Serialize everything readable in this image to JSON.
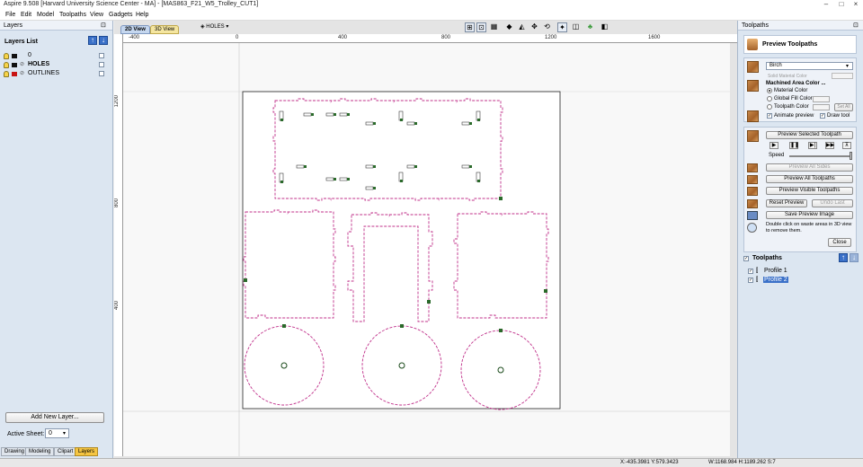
{
  "window": {
    "title": "Aspire 9.508 [Harvard University Science Center - MA] - [MAS863_F21_W5_Trolley_CUT1]",
    "controls": [
      "–",
      "□",
      "×"
    ]
  },
  "menu": [
    "File",
    "Edit",
    "Model",
    "Toolpaths",
    "View",
    "Gadgets",
    "Help"
  ],
  "left_panel": {
    "header": "Layers",
    "section_title": "Layers List",
    "layers": [
      {
        "name": "0",
        "color": "#000000"
      },
      {
        "name": "HOLES",
        "color": "#000000"
      },
      {
        "name": "OUTLINES",
        "color": "#000000"
      }
    ],
    "add_layer_label": "Add New Layer...",
    "active_sheet_label": "Active Sheet:",
    "active_sheet_value": "0",
    "tabs": [
      "Drawing",
      "Modeling",
      "Clipart",
      "Layers"
    ]
  },
  "view": {
    "tabs": [
      "2D View",
      "3D View"
    ],
    "layer_dropdown": "HOLES",
    "ruler_h_labels": [
      "-400",
      "0",
      "400",
      "800",
      "1200",
      "1600"
    ],
    "ruler_v_labels": [
      "1200",
      "800",
      "400"
    ]
  },
  "right_panel": {
    "header": "Toolpaths",
    "preview_title": "Preview Toolpaths",
    "material": "Birch",
    "solid_material_color": "Solid Material Color",
    "machined_area_color": "Machined Area Color ...",
    "radio_options": [
      "Material Color",
      "Global Fill Color",
      "Toolpath Color"
    ],
    "set_all": "Set All",
    "animate_preview": "Animate preview",
    "draw_tool": "Draw tool",
    "preview_selected": "Preview Selected Toolpath",
    "speed_label": "Speed",
    "buttons": {
      "preview_all_sides": "Preview All Sides",
      "preview_all_toolpaths": "Preview All Toolpaths",
      "preview_visible_toolpaths": "Preview Visible Toolpaths",
      "reset_preview": "Reset Preview",
      "undo_last": "Undo Last",
      "save_preview_image": "Save Preview Image",
      "close": "Close"
    },
    "hint": "Double click on waste areas in 3D view to remove them.",
    "toolpaths_title": "Toolpaths",
    "toolpaths": [
      {
        "name": "Profile 1",
        "selected": false
      },
      {
        "name": "Profile 2",
        "selected": true
      }
    ]
  },
  "status": {
    "coords": "X:-435.3981 Y:579.3423",
    "size": "W:1168.984  H:1189.262  S:7"
  },
  "colors": {
    "toolpath": "#c0308a",
    "accent": "#3a70c8"
  }
}
